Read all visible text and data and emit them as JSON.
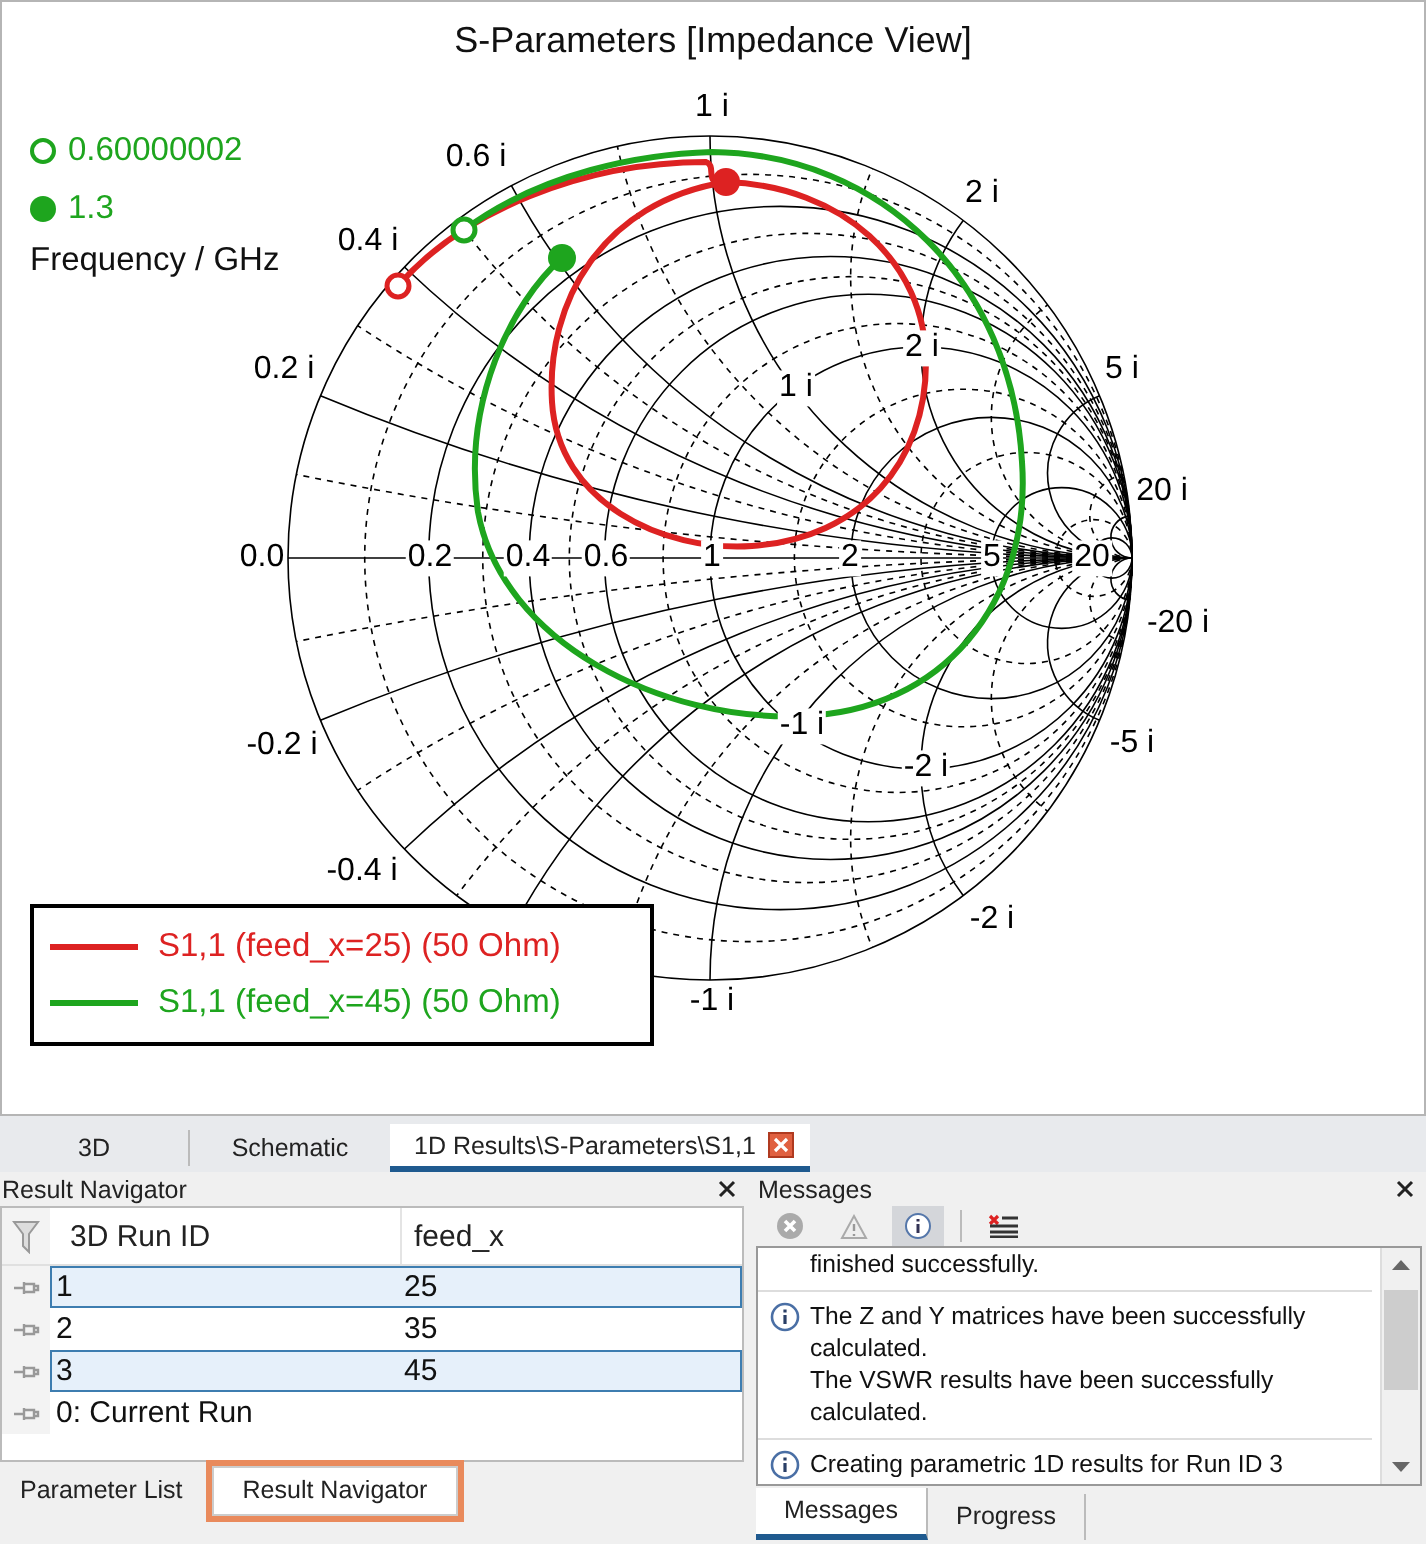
{
  "chart": {
    "title": "S-Parameters [Impedance View]",
    "marker_legend": [
      {
        "label": "0.60000002",
        "kind": "open"
      },
      {
        "label": "1.3",
        "kind": "filled"
      }
    ],
    "marker_legend_caption": "Frequency / GHz",
    "axis_labels": [
      "1 i",
      "0.6 i",
      "0.4 i",
      "0.2 i",
      "0.0",
      "0.2",
      "0.4",
      "0.6",
      "1",
      "2",
      "5",
      "20",
      "2 i",
      "1 i",
      "2 i",
      "5 i",
      "20 i",
      "-20 i",
      "-0.2 i",
      "-1 i",
      "-2 i",
      "-5 i",
      "-0.4 i",
      "-2 i",
      "-1 i"
    ],
    "series": [
      {
        "name": "S1,1 (feed_x=25) (50 Ohm)",
        "color": "#dd2222"
      },
      {
        "name": "S1,1 (feed_x=45) (50 Ohm)",
        "color": "#1ea51e"
      }
    ]
  },
  "document_tabs": [
    {
      "label": "3D",
      "selected": false,
      "closable": false
    },
    {
      "label": "Schematic",
      "selected": false,
      "closable": false
    },
    {
      "label": "1D Results\\S-Parameters\\S1,1",
      "selected": true,
      "closable": true
    }
  ],
  "result_navigator": {
    "title": "Result Navigator",
    "columns": [
      "3D Run ID",
      "feed_x"
    ],
    "rows": [
      {
        "cells": [
          "1",
          "25"
        ],
        "selected": true
      },
      {
        "cells": [
          "2",
          "35"
        ],
        "selected": false
      },
      {
        "cells": [
          "3",
          "45"
        ],
        "selected": true
      },
      {
        "cells": [
          "0: Current Run"
        ],
        "selected": false
      }
    ]
  },
  "messages": {
    "title": "Messages",
    "filters": [
      {
        "kind": "error",
        "selected": false
      },
      {
        "kind": "warning",
        "selected": false
      },
      {
        "kind": "info",
        "selected": true
      },
      {
        "kind": "clear",
        "selected": false
      }
    ],
    "items": [
      {
        "lines": [
          "finished successfully."
        ],
        "has_icon": false
      },
      {
        "lines": [
          "The Z and Y matrices have been successfully calculated.",
          "The VSWR results have been successfully calculated."
        ],
        "has_icon": true
      },
      {
        "lines": [
          "Creating parametric 1D results for Run ID 3"
        ],
        "has_icon": true
      }
    ]
  },
  "left_bottom_tabs": [
    {
      "label": "Parameter List",
      "selected": false,
      "highlighted": false
    },
    {
      "label": "Result Navigator",
      "selected": true,
      "highlighted": true
    }
  ],
  "right_bottom_tabs": [
    {
      "label": "Messages",
      "selected": true
    },
    {
      "label": "Progress",
      "selected": false
    }
  ]
}
